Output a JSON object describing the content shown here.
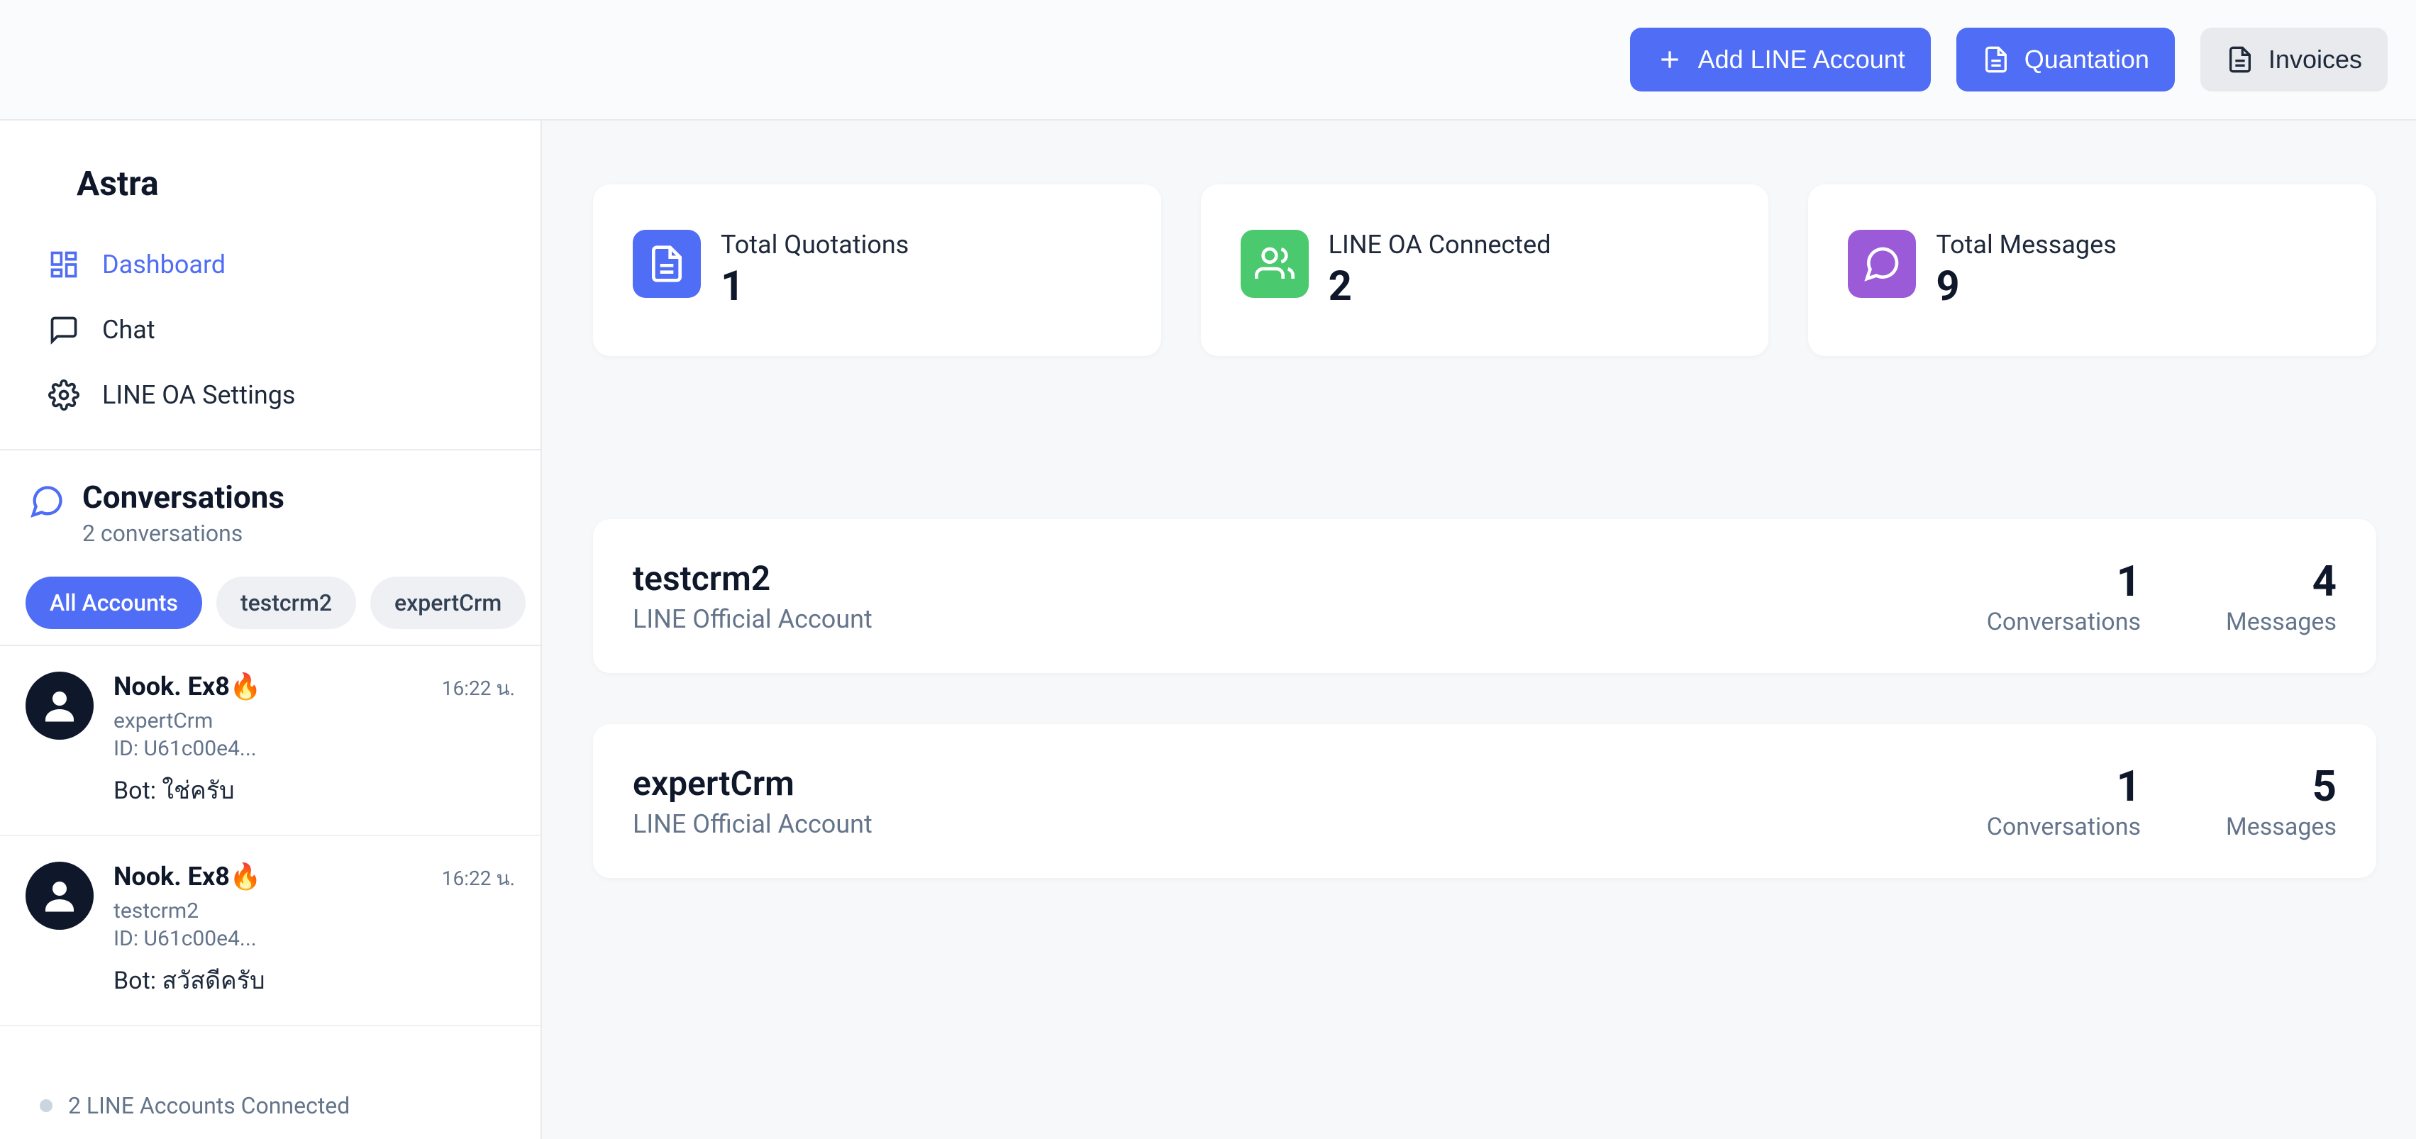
{
  "brand": "Astra",
  "topbar": {
    "add_line": "Add LINE Account",
    "quotation": "Quantation",
    "invoices": "Invoices"
  },
  "nav": {
    "dashboard": "Dashboard",
    "chat": "Chat",
    "settings": "LINE OA Settings"
  },
  "conversations": {
    "title": "Conversations",
    "subtitle": "2 conversations",
    "filters": [
      "All Accounts",
      "testcrm2",
      "expertCrm"
    ],
    "items": [
      {
        "name": "Nook. Ex8🔥",
        "time": "16:22 น.",
        "account": "expertCrm",
        "id": "ID: U61c00e4...",
        "message": "Bot: ใช่ครับ"
      },
      {
        "name": "Nook. Ex8🔥",
        "time": "16:22 น.",
        "account": "testcrm2",
        "id": "ID: U61c00e4...",
        "message": "Bot: สวัสดีครับ"
      }
    ],
    "status": "2 LINE Accounts Connected"
  },
  "stats": [
    {
      "label": "Total Quotations",
      "value": "1",
      "icon": "file",
      "color": "bg-blue"
    },
    {
      "label": "LINE OA Connected",
      "value": "2",
      "icon": "users",
      "color": "bg-green"
    },
    {
      "label": "Total Messages",
      "value": "9",
      "icon": "chat",
      "color": "bg-purple"
    }
  ],
  "accounts": [
    {
      "name": "testcrm2",
      "sub": "LINE Official Account",
      "conversations": "1",
      "messages": "4",
      "conv_label": "Conversations",
      "msg_label": "Messages"
    },
    {
      "name": "expertCrm",
      "sub": "LINE Official Account",
      "conversations": "1",
      "messages": "5",
      "conv_label": "Conversations",
      "msg_label": "Messages"
    }
  ]
}
